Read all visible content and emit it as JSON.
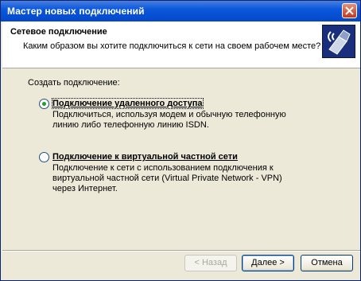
{
  "window": {
    "title": "Мастер новых подключений"
  },
  "header": {
    "title": "Сетевое подключение",
    "subtitle": "Каким образом вы хотите подключиться к сети на своем рабочем месте?"
  },
  "content": {
    "section_label": "Создать подключение:",
    "options": [
      {
        "label": "Подключение удаленного доступа",
        "description": "Подключиться, используя модем и обычную телефонную линию либо телефонную линию ISDN.",
        "selected": true
      },
      {
        "label": "Подключение к виртуальной частной сети",
        "description": "Подключение к сети с использованием подключения к виртуальной частной сети (Virtual Private Network - VPN) через Интернет.",
        "selected": false
      }
    ]
  },
  "buttons": {
    "back": "< Назад",
    "next": "Далее >",
    "cancel": "Отмена"
  }
}
